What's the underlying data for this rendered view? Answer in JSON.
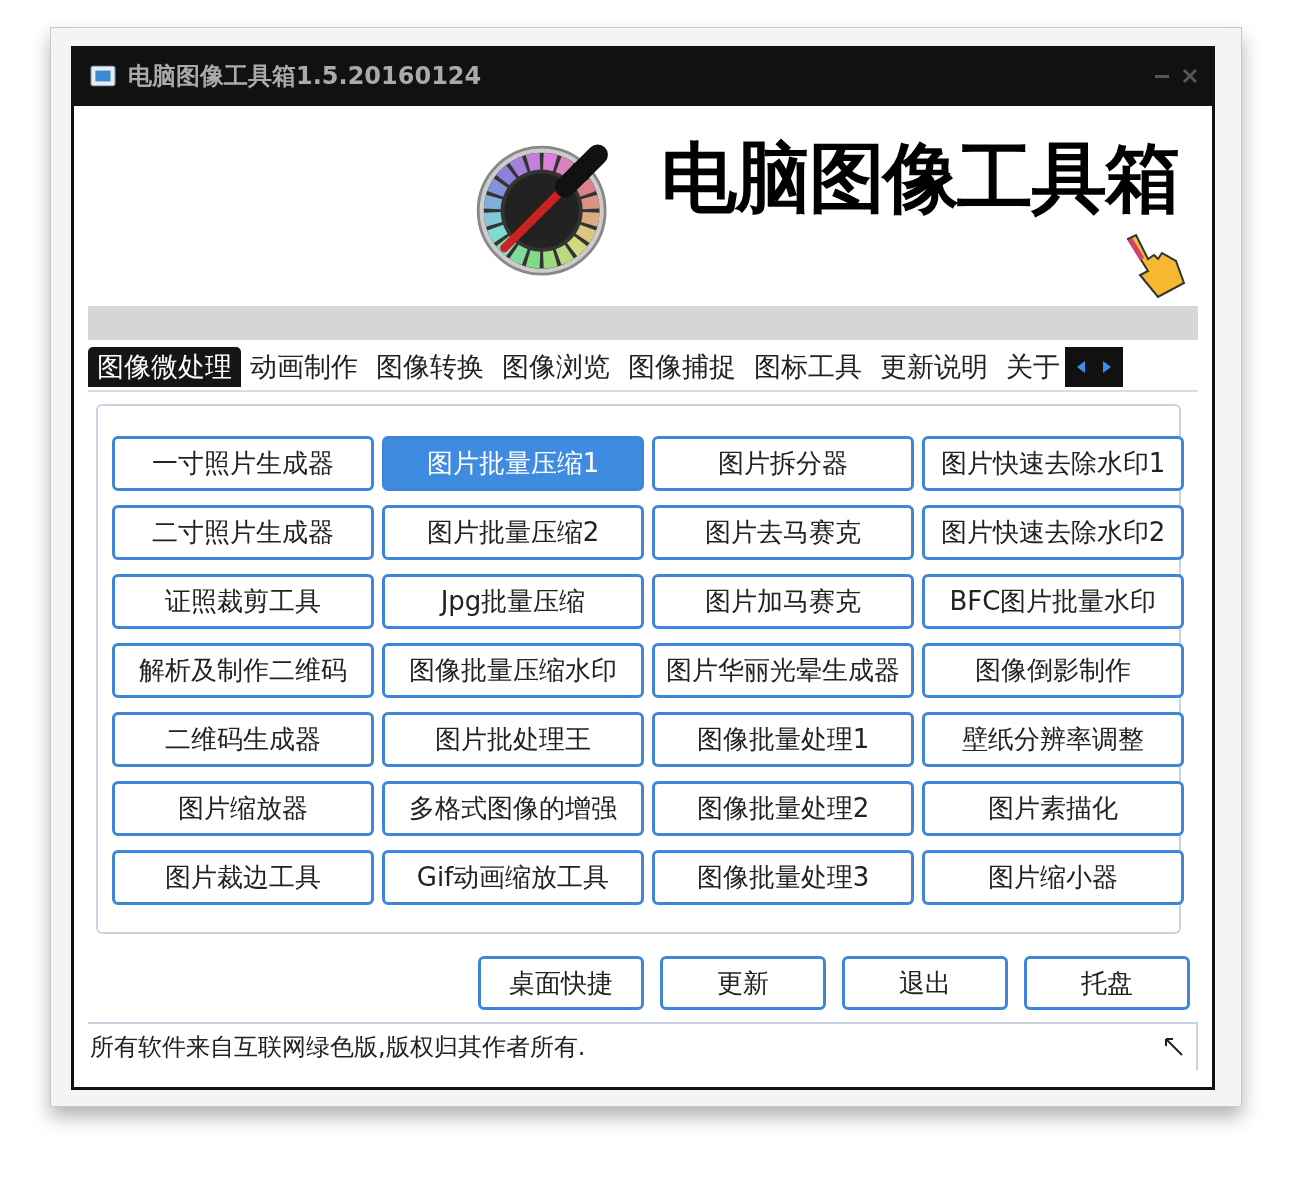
{
  "window": {
    "title": "电脑图像工具箱1.5.20160124"
  },
  "header": {
    "title": "电脑图像工具箱"
  },
  "tabs": [
    {
      "label": "图像微处理",
      "selected": true
    },
    {
      "label": "动画制作",
      "selected": false
    },
    {
      "label": "图像转换",
      "selected": false
    },
    {
      "label": "图像浏览",
      "selected": false
    },
    {
      "label": "图像捕捉",
      "selected": false
    },
    {
      "label": "图标工具",
      "selected": false
    },
    {
      "label": "更新说明",
      "selected": false
    },
    {
      "label": "关于",
      "selected": false
    }
  ],
  "tools": [
    {
      "label": "一寸照片生成器",
      "selected": false
    },
    {
      "label": "图片批量压缩1",
      "selected": true
    },
    {
      "label": "图片拆分器",
      "selected": false
    },
    {
      "label": "图片快速去除水印1",
      "selected": false
    },
    {
      "label": "二寸照片生成器",
      "selected": false
    },
    {
      "label": "图片批量压缩2",
      "selected": false
    },
    {
      "label": "图片去马赛克",
      "selected": false
    },
    {
      "label": "图片快速去除水印2",
      "selected": false
    },
    {
      "label": "证照裁剪工具",
      "selected": false
    },
    {
      "label": "Jpg批量压缩",
      "selected": false
    },
    {
      "label": "图片加马赛克",
      "selected": false
    },
    {
      "label": "BFC图片批量水印",
      "selected": false
    },
    {
      "label": "解析及制作二维码",
      "selected": false
    },
    {
      "label": "图像批量压缩水印",
      "selected": false
    },
    {
      "label": "图片华丽光晕生成器",
      "selected": false
    },
    {
      "label": "图像倒影制作",
      "selected": false
    },
    {
      "label": "二维码生成器",
      "selected": false
    },
    {
      "label": "图片批处理王",
      "selected": false
    },
    {
      "label": "图像批量处理1",
      "selected": false
    },
    {
      "label": "壁纸分辨率调整",
      "selected": false
    },
    {
      "label": "图片缩放器",
      "selected": false
    },
    {
      "label": "多格式图像的增强",
      "selected": false
    },
    {
      "label": "图像批量处理2",
      "selected": false
    },
    {
      "label": "图片素描化",
      "selected": false
    },
    {
      "label": "图片裁边工具",
      "selected": false
    },
    {
      "label": "Gif动画缩放工具",
      "selected": false
    },
    {
      "label": "图像批量处理3",
      "selected": false
    },
    {
      "label": "图片缩小器",
      "selected": false
    }
  ],
  "buttons": [
    "桌面快捷",
    "更新",
    "退出",
    "托盘"
  ],
  "status_bar": {
    "text": "所有软件来自互联网绿色版,版权归其作者所有."
  }
}
